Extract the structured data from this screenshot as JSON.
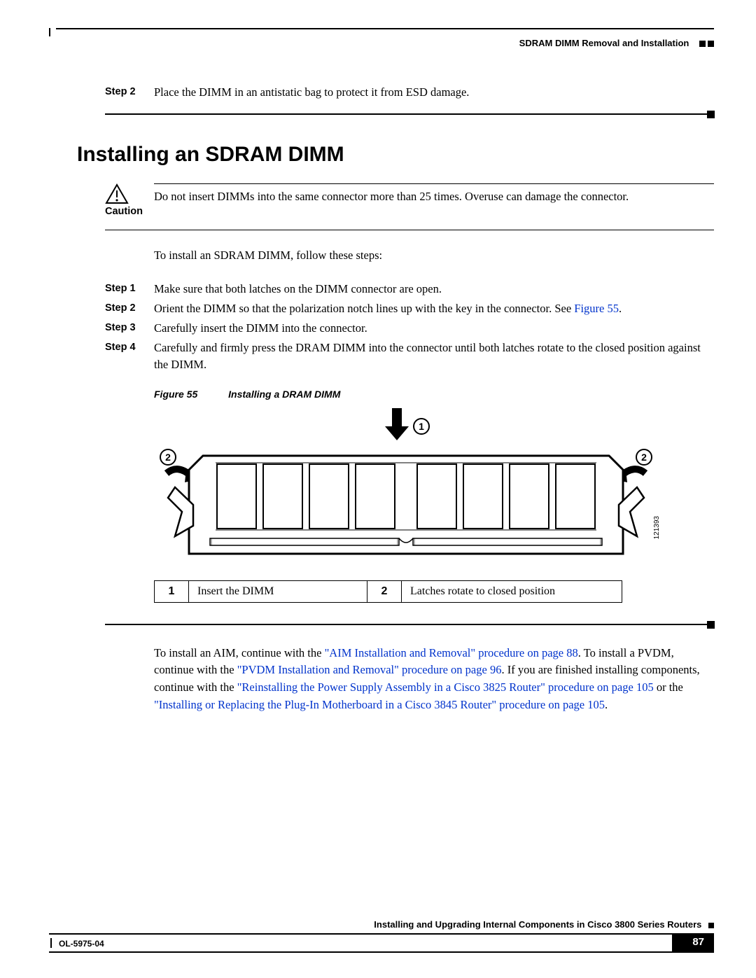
{
  "header": {
    "section_title": "SDRAM DIMM Removal and Installation"
  },
  "prev_step": {
    "label": "Step 2",
    "text": "Place the DIMM in an antistatic bag to protect it from ESD damage."
  },
  "heading": "Installing an SDRAM DIMM",
  "caution": {
    "label": "Caution",
    "text": "Do not insert DIMMs into the same connector more than 25 times. Overuse can damage the connector."
  },
  "intro": "To install an SDRAM DIMM, follow these steps:",
  "steps": [
    {
      "label": "Step 1",
      "text": "Make sure that both latches on the DIMM connector are open."
    },
    {
      "label": "Step 2",
      "text_pre": "Orient the DIMM so that the polarization notch lines up with the key in the connector. See ",
      "link": "Figure 55",
      "text_post": "."
    },
    {
      "label": "Step 3",
      "text": "Carefully insert the DIMM into the connector."
    },
    {
      "label": "Step 4",
      "text": "Carefully and firmly press the DRAM DIMM into the connector until both latches rotate to the closed position against the DIMM."
    }
  ],
  "figure": {
    "label": "Figure 55",
    "title": "Installing a DRAM DIMM",
    "art_number": "121393",
    "callouts": {
      "c1": "1",
      "c2": "2"
    }
  },
  "legend": [
    {
      "num": "1",
      "text": "Insert the DIMM"
    },
    {
      "num": "2",
      "text": "Latches rotate to closed position"
    }
  ],
  "continue": {
    "pre1": "To install an AIM, continue with the ",
    "link1": "\"AIM Installation and Removal\" procedure on page 88",
    "mid1": ". To install a PVDM, continue with the ",
    "link2": "\"PVDM Installation and Removal\" procedure on page 96",
    "mid2": ". If you are finished installing components, continue with the ",
    "link3": "\"Reinstalling the Power Supply Assembly in a Cisco 3825 Router\" procedure on page 105",
    "mid3": " or the ",
    "link4": "\"Installing or Replacing the Plug-In Motherboard in a Cisco 3845 Router\" procedure on page 105",
    "post": "."
  },
  "footer": {
    "book_title": "Installing and Upgrading Internal Components in Cisco 3800 Series Routers",
    "doc_number": "OL-5975-04",
    "page_number": "87"
  }
}
